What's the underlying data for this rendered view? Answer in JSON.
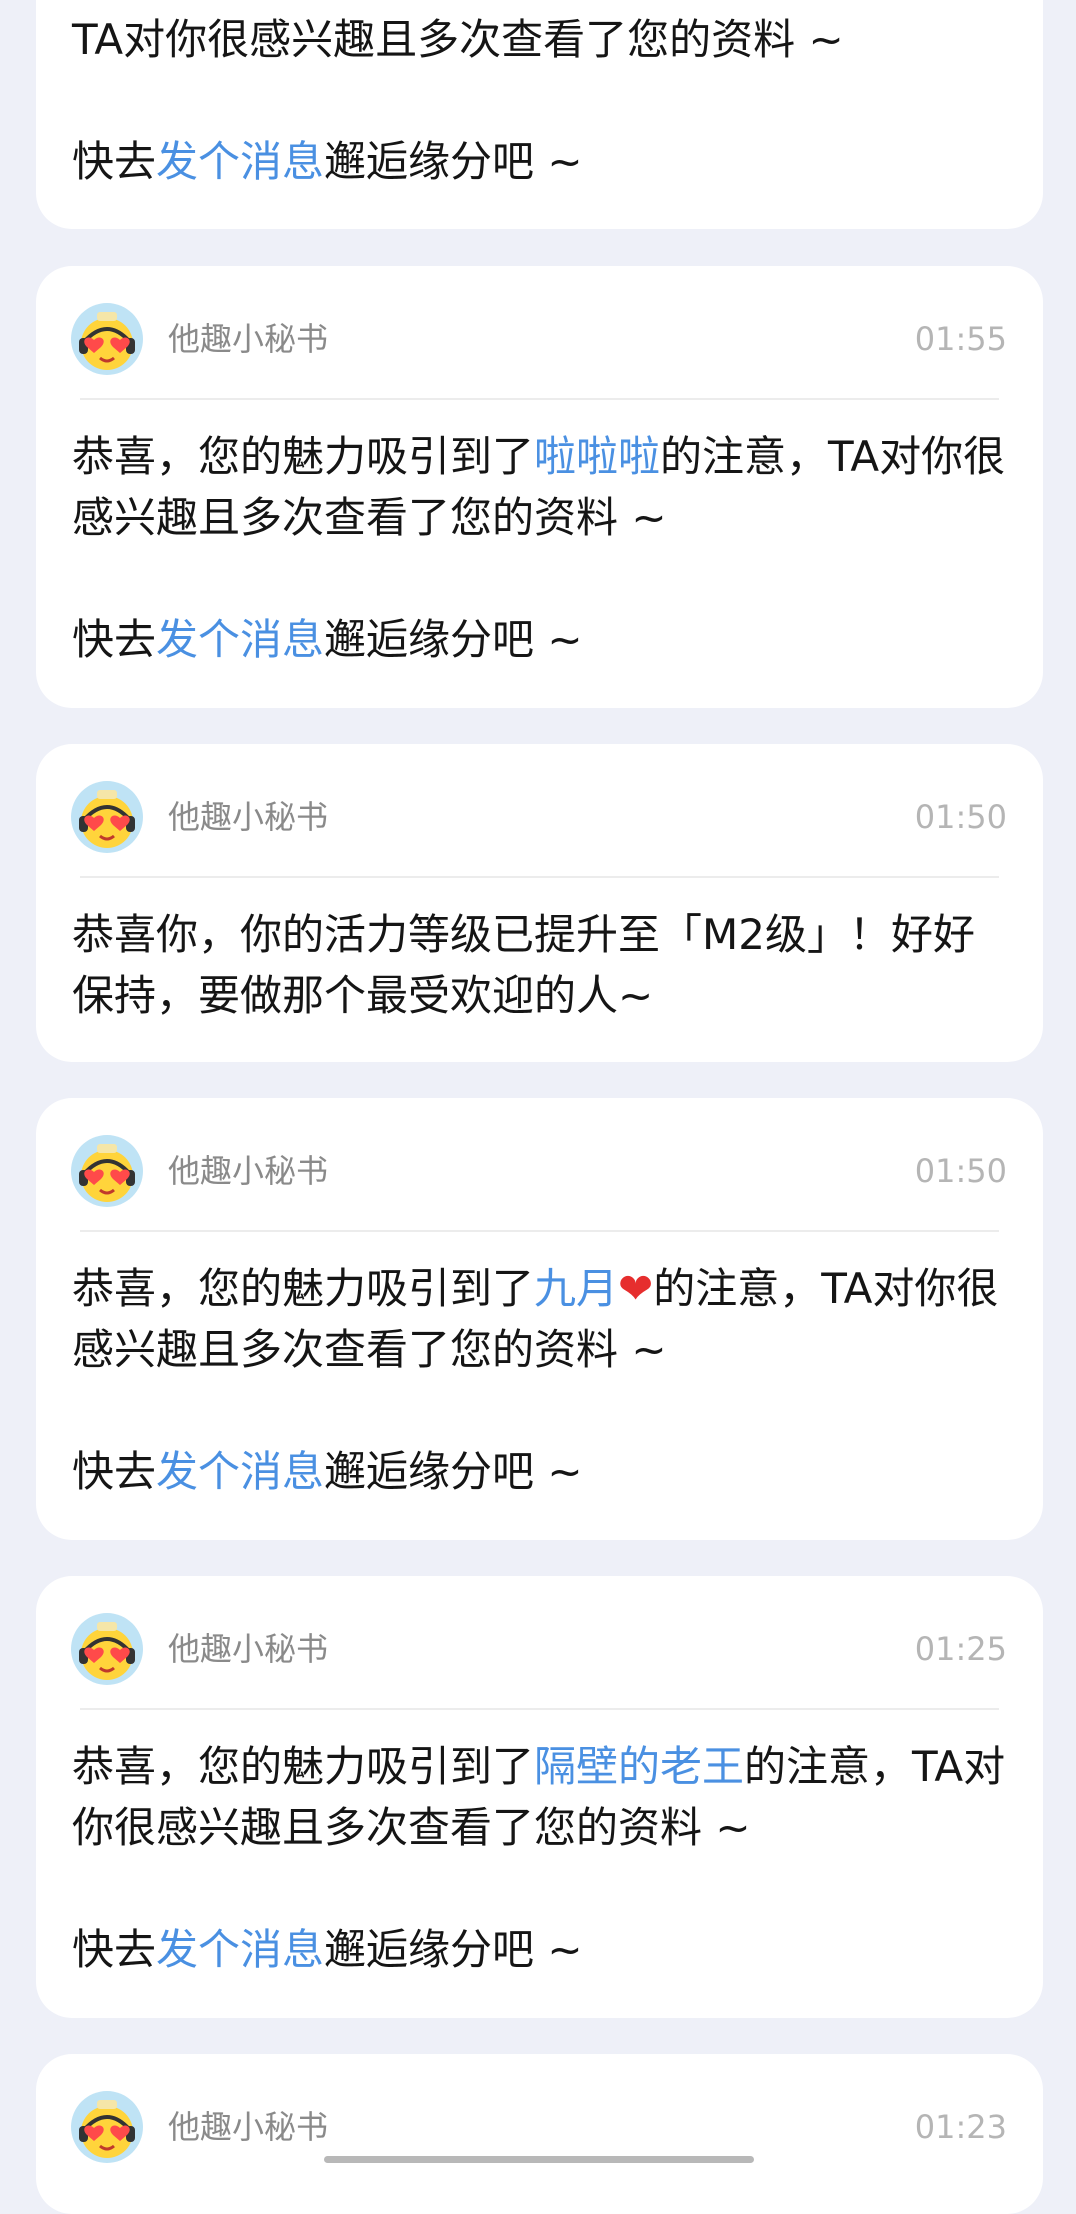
{
  "messages": [
    {
      "sender": "",
      "time": "",
      "lines": {
        "l1": "TA对你很感兴趣且多次查看了您的资料 ~",
        "l2a": "快去",
        "l2link": "发个消息",
        "l2b": "邂逅缘分吧 ~"
      }
    },
    {
      "sender": "他趣小秘书",
      "time": "01:55",
      "intro": "恭喜，您的魅力吸引到了",
      "name": "啦啦啦",
      "after": "的注意，TA对你很感兴趣且多次查看了您的资料 ~",
      "cta_pre": "快去",
      "cta_link": "发个消息",
      "cta_post": "邂逅缘分吧 ~"
    },
    {
      "sender": "他趣小秘书",
      "time": "01:50",
      "text": "恭喜你，你的活力等级已提升至「M2级」！好好保持，要做那个最受欢迎的人~"
    },
    {
      "sender": "他趣小秘书",
      "time": "01:50",
      "intro": "恭喜，您的魅力吸引到了",
      "name": "九月",
      "name_emoji": "❤",
      "after": "的注意，TA对你很感兴趣且多次查看了您的资料 ~",
      "cta_pre": "快去",
      "cta_link": "发个消息",
      "cta_post": "邂逅缘分吧 ~"
    },
    {
      "sender": "他趣小秘书",
      "time": "01:25",
      "intro": "恭喜，您的魅力吸引到了",
      "name": "隔壁的老王",
      "after": "的注意，TA对你很感兴趣且多次查看了您的资料 ~",
      "cta_pre": "快去",
      "cta_link": "发个消息",
      "cta_post": "邂逅缘分吧 ~"
    },
    {
      "sender": "他趣小秘书",
      "time": "01:23"
    }
  ],
  "colors": {
    "link": "#4a90e2",
    "background": "#eef0f8",
    "card": "#ffffff"
  },
  "icons": {
    "avatar": "secretary-avatar-icon"
  }
}
